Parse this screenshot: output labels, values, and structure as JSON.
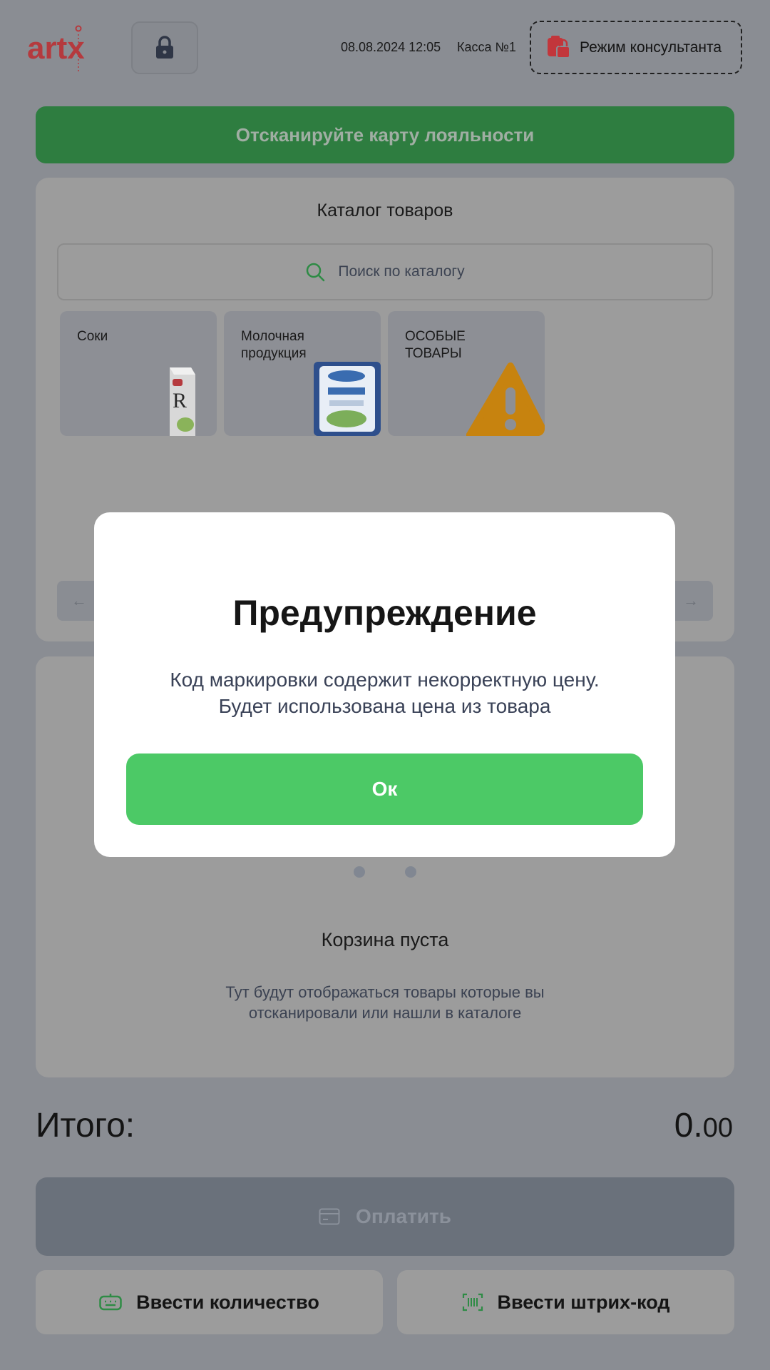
{
  "header": {
    "logo_text": "artx",
    "datetime": "08.08.2024 12:05",
    "register": "Касса №1",
    "consultant_mode": "Режим консультанта"
  },
  "loyalty": {
    "label": "Отсканируйте карту лояльности"
  },
  "catalog": {
    "title": "Каталог товаров",
    "search_placeholder": "Поиск по каталогу",
    "tiles": [
      {
        "name": "Соки"
      },
      {
        "name": "Молочная\nпродукция"
      },
      {
        "name": "ОСОБЫЕ\nТОВАРЫ"
      }
    ]
  },
  "cart": {
    "empty_title": "Корзина пуста",
    "empty_text": "Тут будут отображаться товары которые вы отсканировали или нашли в каталоге"
  },
  "total": {
    "label": "Итого:",
    "whole": "0.",
    "cents": "00"
  },
  "actions": {
    "pay": "Оплатить",
    "enter_quantity": "Ввести количество",
    "enter_barcode": "Ввести штрих-код"
  },
  "modal": {
    "title": "Предупреждение",
    "line1": "Код маркировки содержит некорректную цену.",
    "line2": "Будет использована цена из товара",
    "ok": "Ок"
  },
  "colors": {
    "accent_green": "#4cc966",
    "banner_green": "#2e7d40",
    "overlay_bg": "#8a8d93",
    "brand_red": "#c2363b"
  }
}
